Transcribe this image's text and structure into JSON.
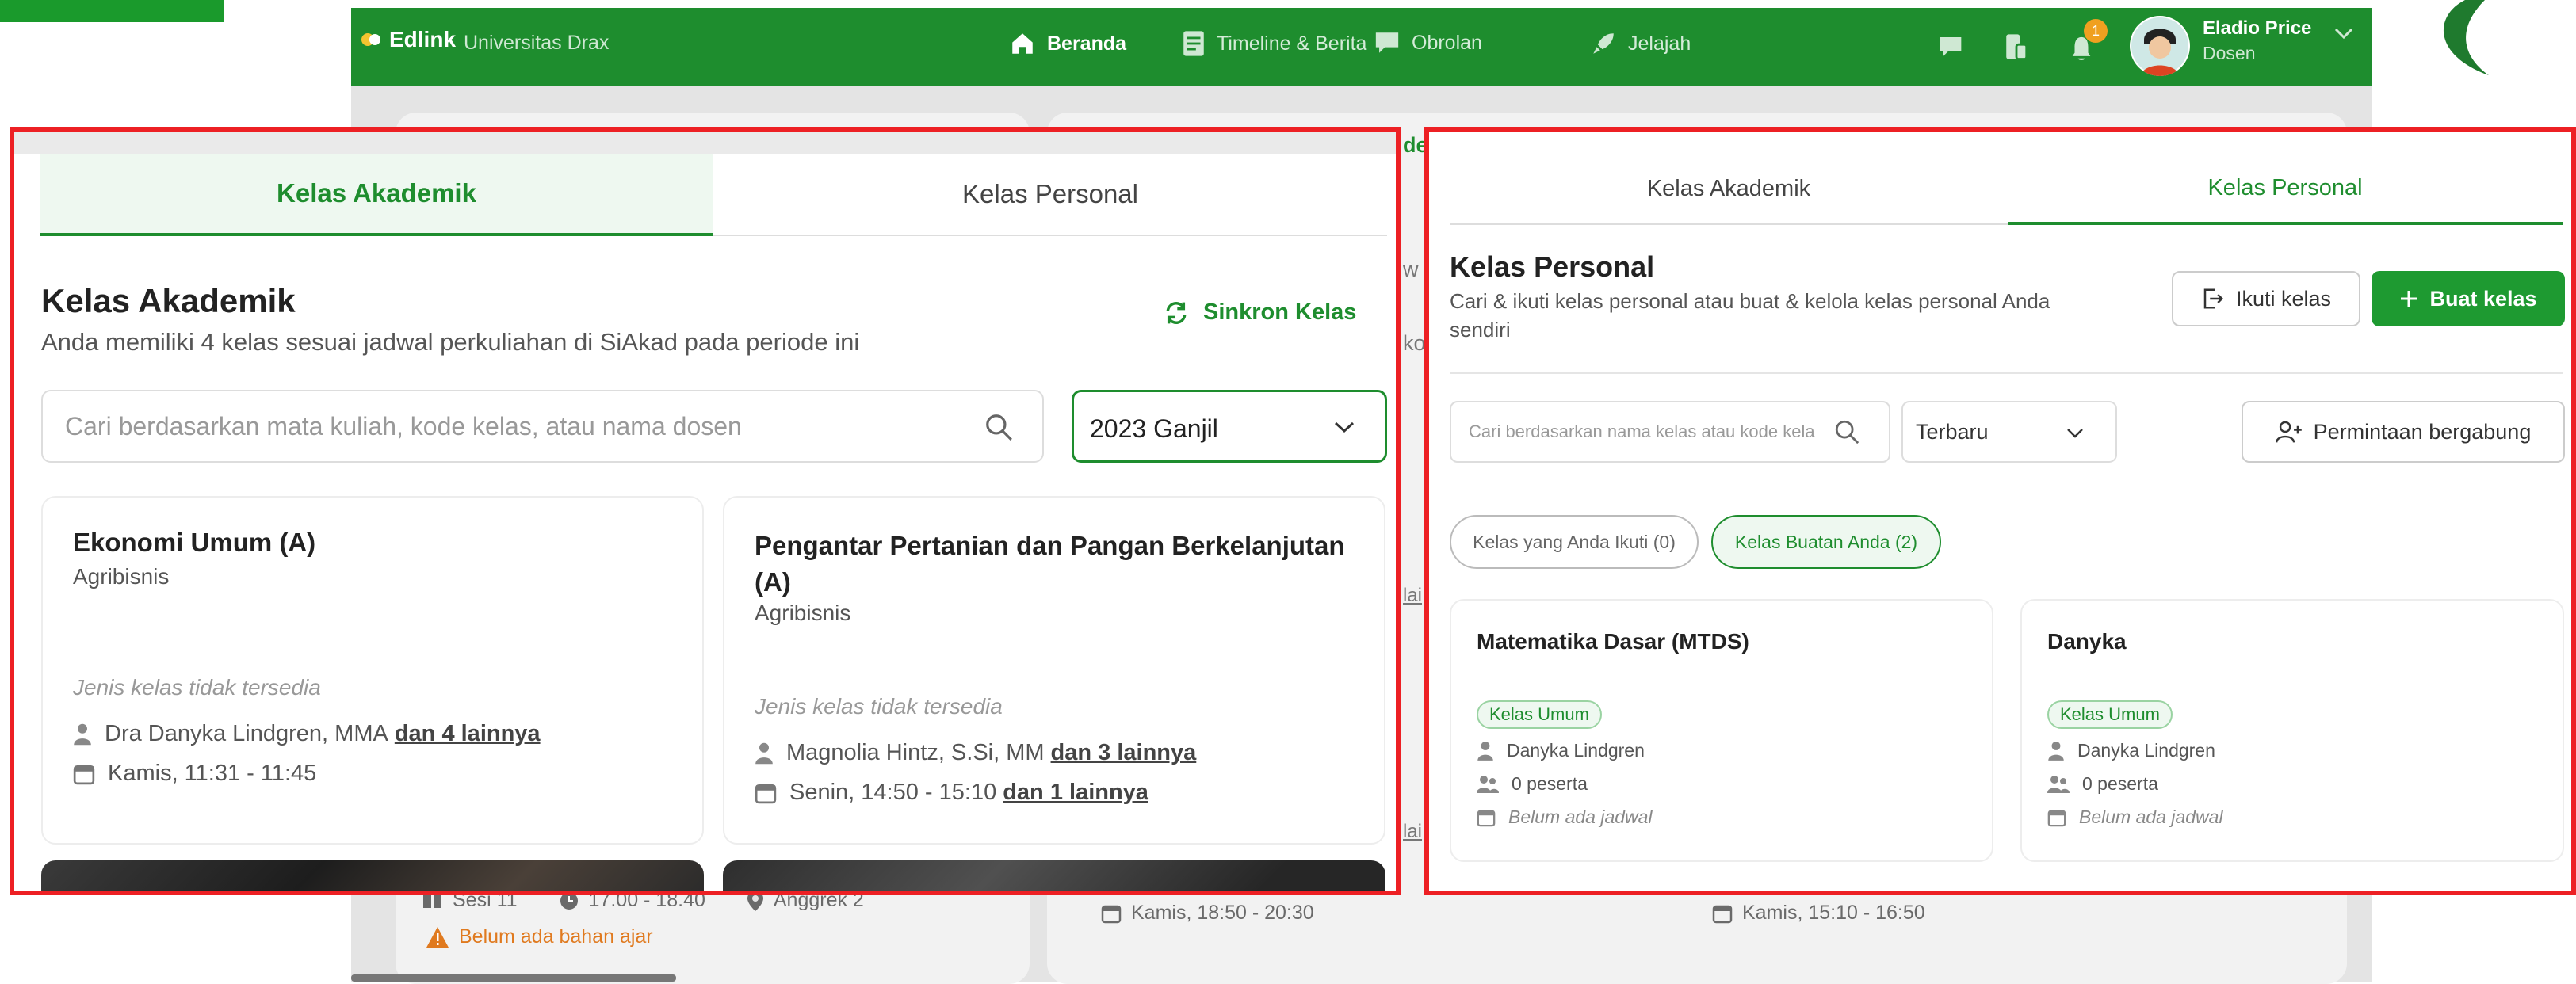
{
  "app": {
    "brand": "Edlink",
    "university": "Universitas Drax",
    "nav": [
      {
        "label": "Beranda",
        "icon": "home-icon"
      },
      {
        "label": "Timeline & Berita",
        "icon": "news-icon"
      },
      {
        "label": "Obrolan",
        "icon": "chat-icon"
      },
      {
        "label": "Jelajah",
        "icon": "rocket-icon"
      }
    ],
    "notification_count": "1",
    "user": {
      "name": "Eladio Price",
      "role": "Dosen"
    }
  },
  "background": {
    "peek_labels": [
      "de",
      "w",
      "ko",
      "lai",
      "lai"
    ],
    "session": {
      "label": "Sesi 11",
      "time": "17.00 - 18.40",
      "room": "Anggrek 2"
    },
    "warning": "Belum ada bahan ajar",
    "schedule_1": "Kamis, 18:50 - 20:30",
    "schedule_2": "Kamis, 15:10 - 16:50"
  },
  "left_panel": {
    "tabs": [
      "Kelas Akademik",
      "Kelas Personal"
    ],
    "active_tab": 0,
    "title": "Kelas Akademik",
    "subtitle": "Anda memiliki 4 kelas sesuai jadwal perkuliahan di SiAkad pada periode ini",
    "sync_label": "Sinkron Kelas",
    "search_placeholder": "Cari berdasarkan mata kuliah, kode kelas, atau nama dosen",
    "period": "2023 Ganjil",
    "classes": [
      {
        "title": "Ekonomi Umum (A)",
        "program": "Agribisnis",
        "type_note": "Jenis kelas tidak tersedia",
        "lecturer": "Dra Danyka Lindgren, MMA",
        "lecturer_more": "dan 4 lainnya",
        "schedule": "Kamis, 11:31 - 11:45",
        "schedule_more": ""
      },
      {
        "title": "Pengantar Pertanian dan Pangan Berkelanjutan (A)",
        "program": "Agribisnis",
        "type_note": "Jenis kelas tidak tersedia",
        "lecturer": "Magnolia Hintz, S.Si, MM",
        "lecturer_more": "dan 3 lainnya",
        "schedule": "Senin, 14:50 - 15:10",
        "schedule_more": "dan 1 lainnya"
      }
    ]
  },
  "right_panel": {
    "tabs": [
      "Kelas Akademik",
      "Kelas Personal"
    ],
    "active_tab": 1,
    "title": "Kelas Personal",
    "subtitle": "Cari & ikuti kelas personal atau buat & kelola kelas personal Anda sendiri",
    "join_label": "Ikuti kelas",
    "create_label": "Buat kelas",
    "search_placeholder": "Cari berdasarkan nama kelas atau kode kela",
    "sort": "Terbaru",
    "requests_label": "Permintaan bergabung",
    "filters": [
      "Kelas yang Anda Ikuti (0)",
      "Kelas Buatan Anda (2)"
    ],
    "active_filter": 1,
    "classes": [
      {
        "title": "Matematika Dasar (MTDS)",
        "badge": "Kelas Umum",
        "owner": "Danyka Lindgren",
        "participants": "0 peserta",
        "schedule": "Belum ada jadwal"
      },
      {
        "title": "Danyka",
        "badge": "Kelas Umum",
        "owner": "Danyka Lindgren",
        "participants": "0 peserta",
        "schedule": "Belum ada jadwal"
      }
    ]
  },
  "colors": {
    "brand_green": "#1e8d2e",
    "highlight_red": "#ed2024",
    "warning_orange": "#e07a1f"
  }
}
